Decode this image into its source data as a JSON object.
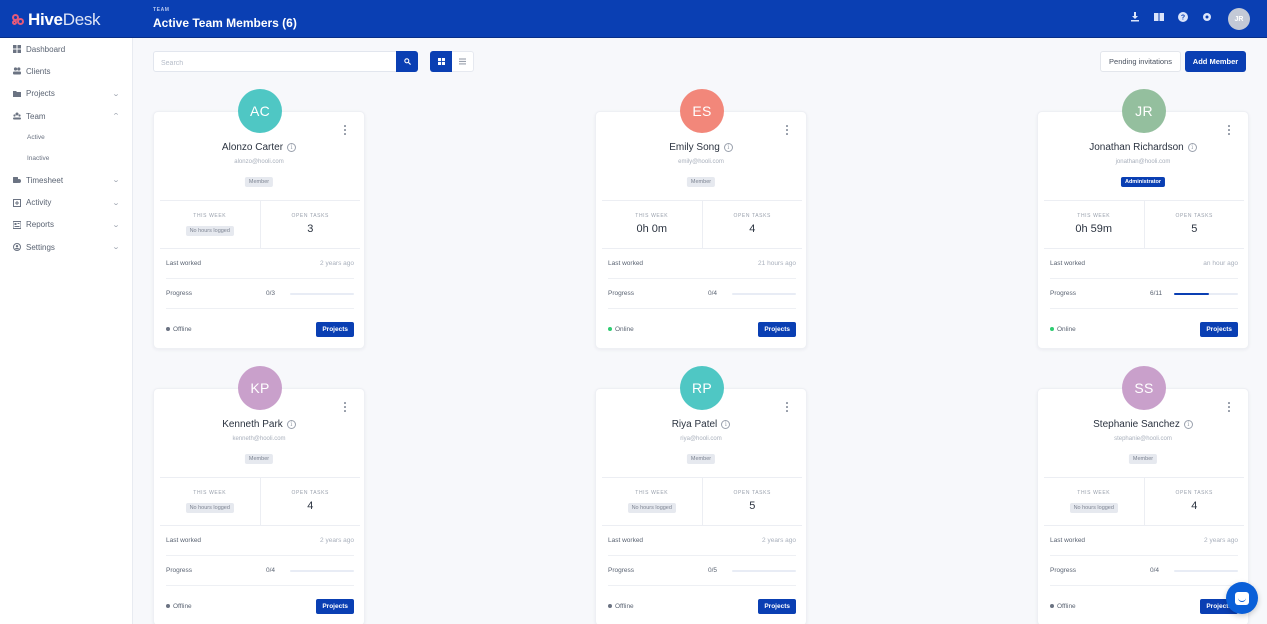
{
  "app": {
    "logo_bold": "Hive",
    "logo_light": "Desk",
    "kicker": "TEAM",
    "title": "Active Team Members (6)",
    "user_initials": "JR",
    "brand_color": "#0a3fb3",
    "header_icons": [
      "download-icon",
      "book-icon",
      "help-icon",
      "settings-gear-icon"
    ]
  },
  "sidebar": {
    "items": [
      {
        "label": "Dashboard",
        "icon": "dashboard-icon",
        "chevron": ""
      },
      {
        "label": "Clients",
        "icon": "clients-icon",
        "chevron": ""
      },
      {
        "label": "Projects",
        "icon": "folder-icon",
        "chevron": "⌄"
      },
      {
        "label": "Team",
        "icon": "team-icon",
        "chevron": "⌃"
      },
      {
        "label": "Timesheet",
        "icon": "timesheet-icon",
        "chevron": "⌄"
      },
      {
        "label": "Activity",
        "icon": "activity-icon",
        "chevron": "⌄"
      },
      {
        "label": "Reports",
        "icon": "reports-icon",
        "chevron": "⌄"
      },
      {
        "label": "Settings",
        "icon": "settings-icon",
        "chevron": "⌄"
      }
    ],
    "team_sub": [
      "Active",
      "Inactive"
    ]
  },
  "toolbar": {
    "search_placeholder": "Search",
    "search_value": "",
    "pending_label": "Pending invitations",
    "add_label": "Add Member",
    "view_mode": "grid"
  },
  "card_labels": {
    "this_week": "THIS WEEK",
    "open_tasks": "OPEN TASKS",
    "last_worked": "Last worked",
    "progress": "Progress",
    "projects_button": "Projects",
    "no_hours": "No hours logged"
  },
  "members": [
    {
      "initials": "AC",
      "name": "Alonzo Carter",
      "email": "alonzo@hooli.com",
      "role": "Member",
      "this_week": "",
      "open_tasks": "3",
      "last_worked": "2 years ago",
      "progress_done": 0,
      "progress_total": 3,
      "progress_text": "0/3",
      "status": "Offline",
      "avatar_color": "#4fc7c4"
    },
    {
      "initials": "ES",
      "name": "Emily Song",
      "email": "emily@hooli.com",
      "role": "Member",
      "this_week": "0h 0m",
      "open_tasks": "4",
      "last_worked": "21 hours ago",
      "progress_done": 0,
      "progress_total": 4,
      "progress_text": "0/4",
      "status": "Online",
      "avatar_color": "#f2877a"
    },
    {
      "initials": "JR",
      "name": "Jonathan Richardson",
      "email": "jonathan@hooli.com",
      "role": "Administrator",
      "this_week": "0h 59m",
      "open_tasks": "5",
      "last_worked": "an hour ago",
      "progress_done": 6,
      "progress_total": 11,
      "progress_text": "6/11",
      "status": "Online",
      "avatar_color": "#94bf9e"
    },
    {
      "initials": "KP",
      "name": "Kenneth Park",
      "email": "kenneth@hooli.com",
      "role": "Member",
      "this_week": "",
      "open_tasks": "4",
      "last_worked": "2 years ago",
      "progress_done": 0,
      "progress_total": 4,
      "progress_text": "0/4",
      "status": "Offline",
      "avatar_color": "#c9a0cb"
    },
    {
      "initials": "RP",
      "name": "Riya Patel",
      "email": "riya@hooli.com",
      "role": "Member",
      "this_week": "",
      "open_tasks": "5",
      "last_worked": "2 years ago",
      "progress_done": 0,
      "progress_total": 5,
      "progress_text": "0/5",
      "status": "Offline",
      "avatar_color": "#4fc7c4"
    },
    {
      "initials": "SS",
      "name": "Stephanie Sanchez",
      "email": "stephanie@hooli.com",
      "role": "Member",
      "this_week": "",
      "open_tasks": "4",
      "last_worked": "2 years ago",
      "progress_done": 0,
      "progress_total": 4,
      "progress_text": "0/4",
      "status": "Offline",
      "avatar_color": "#c9a0cb"
    }
  ],
  "status_colors": {
    "Online": "#2ecc71",
    "Offline": "#6b7382"
  }
}
